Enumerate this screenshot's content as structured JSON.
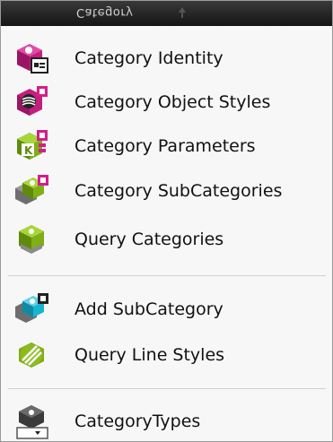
{
  "menu": {
    "title": "Category",
    "items": [
      {
        "label": "Category Identity",
        "icon": "category-identity-icon"
      },
      {
        "label": "Category Object Styles",
        "icon": "category-object-styles-icon"
      },
      {
        "label": "Category Parameters",
        "icon": "category-parameters-icon"
      },
      {
        "label": "Category SubCategories",
        "icon": "category-subcategories-icon"
      },
      {
        "label": "Query Categories",
        "icon": "query-categories-icon"
      },
      {
        "label": "Add SubCategory",
        "icon": "add-subcategory-icon"
      },
      {
        "label": "Query Line Styles",
        "icon": "query-line-styles-icon"
      },
      {
        "label": "CategoryTypes",
        "icon": "category-types-icon"
      }
    ]
  },
  "colors": {
    "accent_green": "#8dbb1f",
    "accent_magenta": "#d41d8a",
    "accent_cyan": "#17b4d1",
    "dark_gray": "#3a3a3a"
  }
}
